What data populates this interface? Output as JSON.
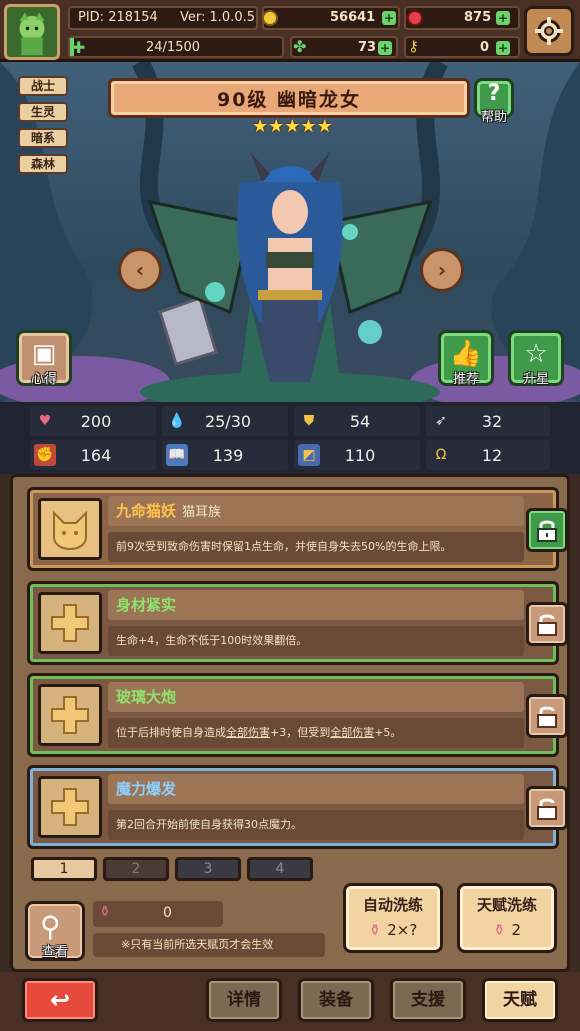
{
  "top": {
    "pid": "PID: 218154",
    "version": "Ver: 1.0.0.5",
    "gold": "56641",
    "gems": "875",
    "energy": "24/1500",
    "clover": "73",
    "keys": "0"
  },
  "tags": [
    "战士",
    "生灵",
    "暗系",
    "森林"
  ],
  "hero": {
    "title": "90级 幽暗龙女",
    "stars": 5,
    "help_label": "帮助",
    "notes_label": "心得",
    "recommend_label": "推荐",
    "upgrade_label": "升星"
  },
  "stats": {
    "hp": "200",
    "mana": "25/30",
    "defense": "54",
    "speed": "32",
    "attack": "164",
    "magic": "139",
    "resist": "110",
    "luck": "12"
  },
  "talents": [
    {
      "title": "九命猫妖",
      "sub": "猫耳族",
      "desc": "前9次受到致命伤害时保留1点生命，并使自身失去50%的生命上限。",
      "frame": "#c89a5a",
      "title_color": "#ffc24a"
    },
    {
      "title": "身材紧实",
      "sub": "",
      "desc": "生命+4，生命不低于100时效果翻倍。",
      "frame": "#6fbf5a",
      "title_color": "#8fe36b"
    },
    {
      "title": "玻璃大炮",
      "sub": "",
      "desc_a": "位于后排时使自身造成",
      "desc_b": "全部伤害",
      "desc_c": "+3，但受到",
      "desc_d": "全部伤害",
      "desc_e": "+5。",
      "frame": "#6fbf5a",
      "title_color": "#8fe36b"
    },
    {
      "title": "魔力爆发",
      "sub": "",
      "desc": "第2回合开始前使自身获得30点魔力。",
      "frame": "#7fb2d8",
      "title_color": "#8fd0ff"
    }
  ],
  "pages": [
    "1",
    "2",
    "3",
    "4"
  ],
  "potion_count": "0",
  "notice": "※只有当前所选天赋页才会生效",
  "view_label": "查看",
  "auto_wash": {
    "label": "自动洗练",
    "cost": "2×?"
  },
  "talent_wash": {
    "label": "天赋洗练",
    "cost": "2"
  },
  "nav": {
    "details": "详情",
    "equip": "装备",
    "support": "支援",
    "talent": "天赋"
  },
  "colors": {
    "accent_gold": "#f0c24a",
    "accent_green": "#6bd36b",
    "danger_red": "#e54a3a"
  }
}
